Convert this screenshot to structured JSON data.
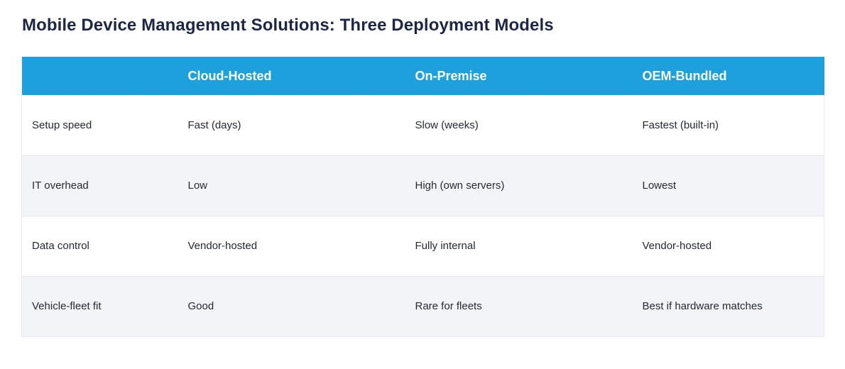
{
  "title": "Mobile Device Management Solutions: Three Deployment Models",
  "table": {
    "headers": [
      "",
      "Cloud-Hosted",
      "On-Premise",
      "OEM-Bundled"
    ],
    "rows": [
      [
        "Setup speed",
        "Fast (days)",
        "Slow (weeks)",
        "Fastest (built-in)"
      ],
      [
        "IT overhead",
        "Low",
        "High (own servers)",
        "Lowest"
      ],
      [
        "Data control",
        "Vendor-hosted",
        "Fully internal",
        "Vendor-hosted"
      ],
      [
        "Vehicle-fleet fit",
        "Good",
        "Rare for fleets",
        "Best if hardware matches"
      ]
    ]
  },
  "colors": {
    "header_bg": "#1ea0dc",
    "title": "#1c2745",
    "row_alt": "#f3f4f8"
  }
}
